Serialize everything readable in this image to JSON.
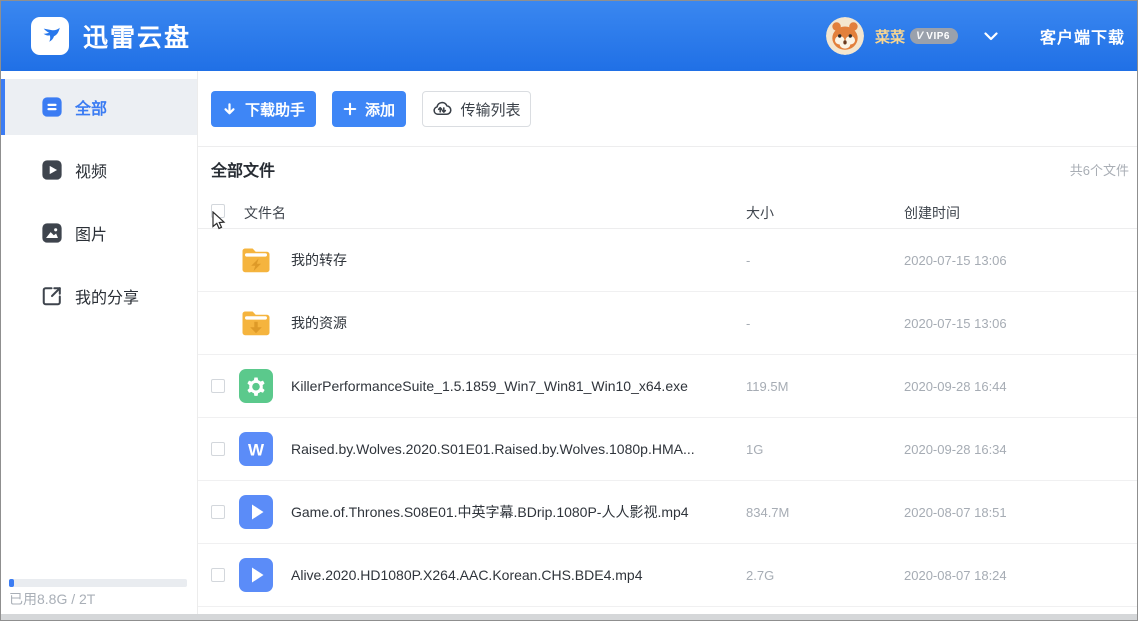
{
  "header": {
    "app_name": "迅雷云盘",
    "username": "菜菜",
    "vip_v": "V",
    "vip_label": "VIP6",
    "client_download_label": "客户端下载"
  },
  "sidebar": {
    "items": [
      {
        "label": "全部",
        "icon": "all-files-icon",
        "active": true
      },
      {
        "label": "视频",
        "icon": "video-icon",
        "active": false
      },
      {
        "label": "图片",
        "icon": "image-icon",
        "active": false
      },
      {
        "label": "我的分享",
        "icon": "share-icon",
        "active": false
      }
    ],
    "storage": {
      "text": "已用8.8G / 2T",
      "used": "8.8G",
      "total": "2T"
    }
  },
  "toolbar": {
    "buttons": [
      {
        "label": "下载助手",
        "icon": "download-arrow-icon",
        "style": "primary"
      },
      {
        "label": "添加",
        "icon": "plus-icon",
        "style": "primary"
      },
      {
        "label": "传输列表",
        "icon": "cloud-transfer-icon",
        "style": "default"
      }
    ]
  },
  "files": {
    "section_title": "全部文件",
    "count_label": "共6个文件",
    "columns": {
      "name": "文件名",
      "size": "大小",
      "created": "创建时间"
    },
    "rows": [
      {
        "name": "我的转存",
        "icon": "folder-transfer-icon",
        "size": "-",
        "created": "2020-07-15 13:06",
        "has_checkbox": false
      },
      {
        "name": "我的资源",
        "icon": "folder-download-icon",
        "size": "-",
        "created": "2020-07-15 13:06",
        "has_checkbox": false
      },
      {
        "name": "KillerPerformanceSuite_1.5.1859_Win7_Win81_Win10_x64.exe",
        "icon": "exe-gear-icon",
        "size": "119.5M",
        "created": "2020-09-28 16:44",
        "has_checkbox": true
      },
      {
        "name": "Raised.by.Wolves.2020.S01E01.Raised.by.Wolves.1080p.HMA...",
        "icon": "doc-w-icon",
        "size": "1G",
        "created": "2020-09-28 16:34",
        "has_checkbox": true
      },
      {
        "name": "Game.of.Thrones.S08E01.中英字幕.BDrip.1080P-人人影视.mp4",
        "icon": "video-play-icon",
        "size": "834.7M",
        "created": "2020-08-07 18:51",
        "has_checkbox": true
      },
      {
        "name": "Alive.2020.HD1080P.X264.AAC.Korean.CHS.BDE4.mp4",
        "icon": "video-play-icon",
        "size": "2.7G",
        "created": "2020-08-07 18:24",
        "has_checkbox": true
      }
    ]
  },
  "colors": {
    "header_blue_top": "#3a87f0",
    "header_blue_bottom": "#2070e6",
    "accent_blue": "#3b7cf3",
    "button_blue": "#3e86f6",
    "folder_yellow": "#f5b43e",
    "folder_glyph_orange": "#de9a28",
    "exe_green": "#5bc98c",
    "file_blue": "#5b8cf8",
    "vip_gray": "#9aa1ac",
    "username_gold": "#f6d592",
    "muted_text": "#a6acb4"
  }
}
